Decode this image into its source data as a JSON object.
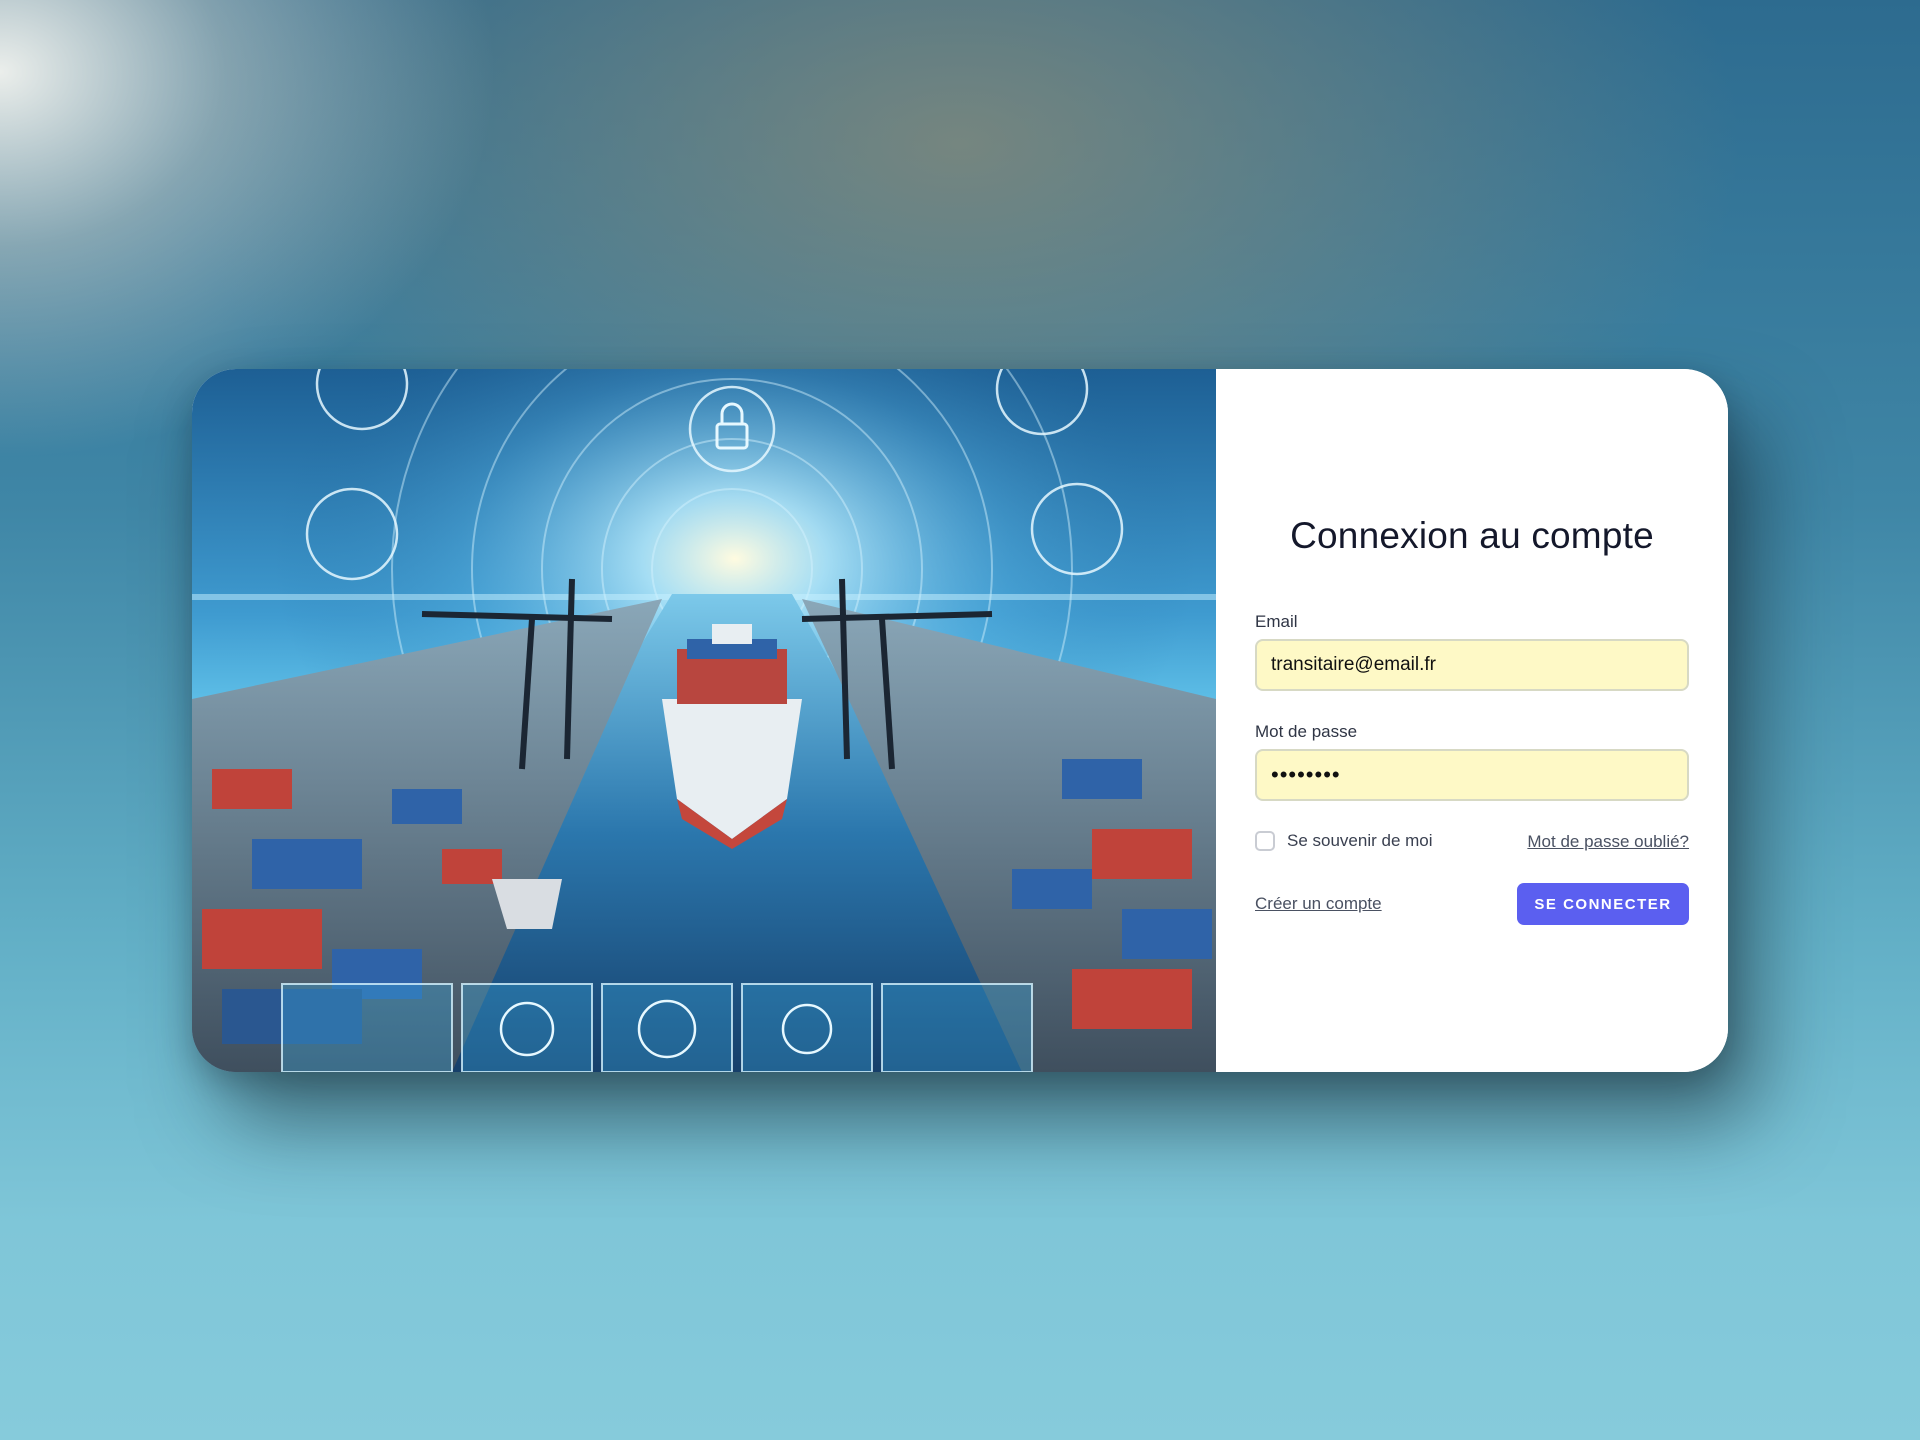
{
  "hero": {
    "icons": [
      "scale-icon",
      "lock-icon",
      "crane-icon",
      "bulb-icon",
      "document-icon"
    ]
  },
  "login": {
    "title": "Connexion au compte",
    "email_label": "Email",
    "email_value": "transitaire@email.fr",
    "password_label": "Mot de passe",
    "password_value": "••••••••",
    "remember_label": "Se souvenir de moi",
    "remember_checked": false,
    "forgot_link": "Mot de passe oublié?",
    "create_link": "Créer un compte",
    "submit_label": "SE CONNECTER"
  },
  "colors": {
    "accent": "#5b5ff0",
    "input_fill": "#fef9c6",
    "title_text": "#14182b"
  }
}
